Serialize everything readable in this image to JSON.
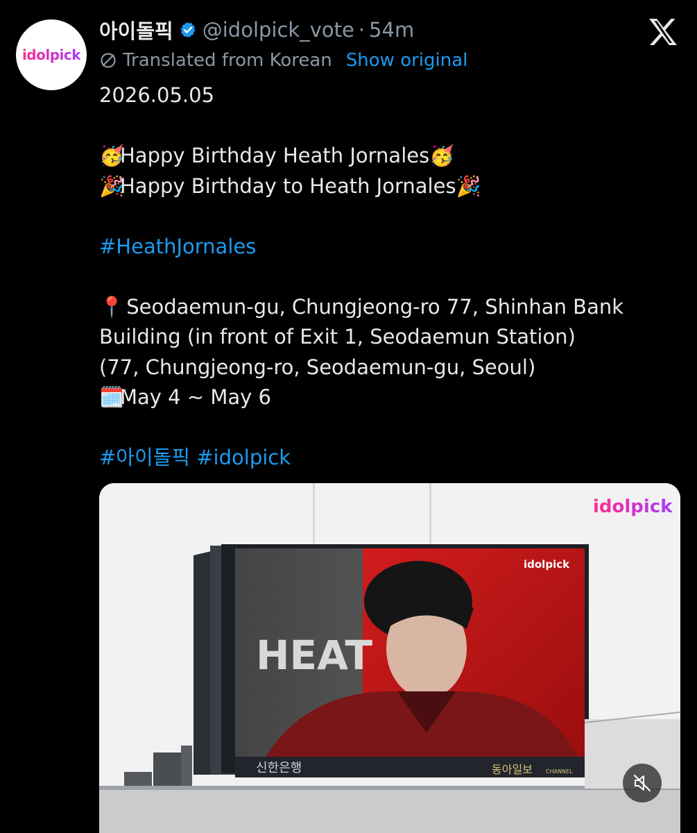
{
  "author": {
    "display_name": "아이돌픽",
    "handle": "@idolpick_vote",
    "time": "54m",
    "avatar_text": "idolpick"
  },
  "translation": {
    "label": "Translated from Korean",
    "show_original": "Show original"
  },
  "tweet": {
    "date": "2026.05.05",
    "line1_emoji": "🥳",
    "line1": "Happy Birthday Heath Jornales",
    "line2_emoji": "🎉",
    "line2": "Happy Birthday to Heath Jornales",
    "hashtag1": "#HeathJornales",
    "location_emoji": "📍",
    "address_line1": "Seodaemun-gu, Chungjeong-ro 77, Shinhan Bank",
    "address_line2": "Building (in front of Exit 1, Seodaemun Station)",
    "address_line3": "(77, Chungjeong-ro, Seodaemun-gu, Seoul)",
    "calendar_emoji": "🗓️",
    "dates": "May 4 ~ May 6",
    "hashtag2": "#아이돌픽",
    "hashtag3": "#idolpick"
  },
  "media": {
    "watermark": "idolpick",
    "billboard_logo": "idolpick",
    "billboard_text": "HEAT",
    "sponsor_left": "신한은행",
    "sponsor_right": "동아일보",
    "sponsor_right_sub": "CHANNEL"
  },
  "colors": {
    "link": "#1d9bf0",
    "muted": "#8b98a5",
    "brand_pink": "#ff2d8f",
    "brand_purple": "#a83cff"
  },
  "icons": [
    "verified-badge-icon",
    "x-logo-icon",
    "translate-icon",
    "mute-icon"
  ]
}
